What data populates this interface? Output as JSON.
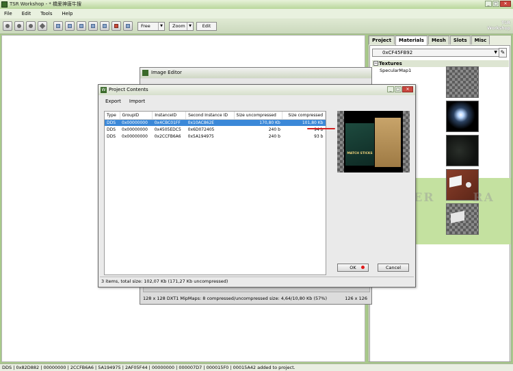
{
  "window": {
    "title": "TSR Workshop - * 橋爱神唐牛搜"
  },
  "menu": [
    "File",
    "Edit",
    "Tools",
    "Help"
  ],
  "toolbar": {
    "mode": "Free",
    "zoom": "Zoom",
    "edit": "Edit"
  },
  "logo": {
    "text": "TSR Workshop"
  },
  "panel": {
    "tabs": [
      "Project",
      "Materials",
      "Mesh",
      "Slots",
      "Misc"
    ],
    "active_tab": "Materials",
    "material": "0xCF45FB92",
    "section": "Textures",
    "texture_label": "SpecularMap1"
  },
  "image_editor": {
    "title": "Image Editor",
    "status": "128 x 128 DXT1 MipMaps: 8 compressed/uncompressed size: 4,64/10,80 Kb (57%)",
    "dims": "126 x 126"
  },
  "project_contents": {
    "title": "Project Contents",
    "menu": [
      "Export",
      "Import"
    ],
    "columns": [
      "Type",
      "GroupID",
      "InstanceID",
      "Second Instance ID",
      "Size uncompressed",
      "Size compressed"
    ],
    "rows": [
      [
        "DDS",
        "0x00000000",
        "0x4CBC01FF",
        "0x10AC862E",
        "170,80 Kb",
        "101,80 Kb"
      ],
      [
        "DDS",
        "0x00000000",
        "0x4505EDC5",
        "0x6D072405",
        "240 b",
        "94 b"
      ],
      [
        "DDS",
        "0x00000000",
        "0x2CCFB6A6",
        "0x5A194975",
        "240 b",
        "93 b"
      ]
    ],
    "selected_row": 0,
    "ok": "OK",
    "cancel": "Cancel",
    "status": "3 items, total size: 102,07 Kb (171,27 Kb uncompressed)",
    "preview_text": "MATCH STICKS"
  },
  "watermark": "SEVER",
  "watermark2": "RA",
  "statusbar": "DDS | 0x82D882 | 00000000 | 2CCFB6A6 | 5A194975 | 2AF05F44 | 00000000 | 000007D7 | 000015F0 | 00015A42 added to project."
}
